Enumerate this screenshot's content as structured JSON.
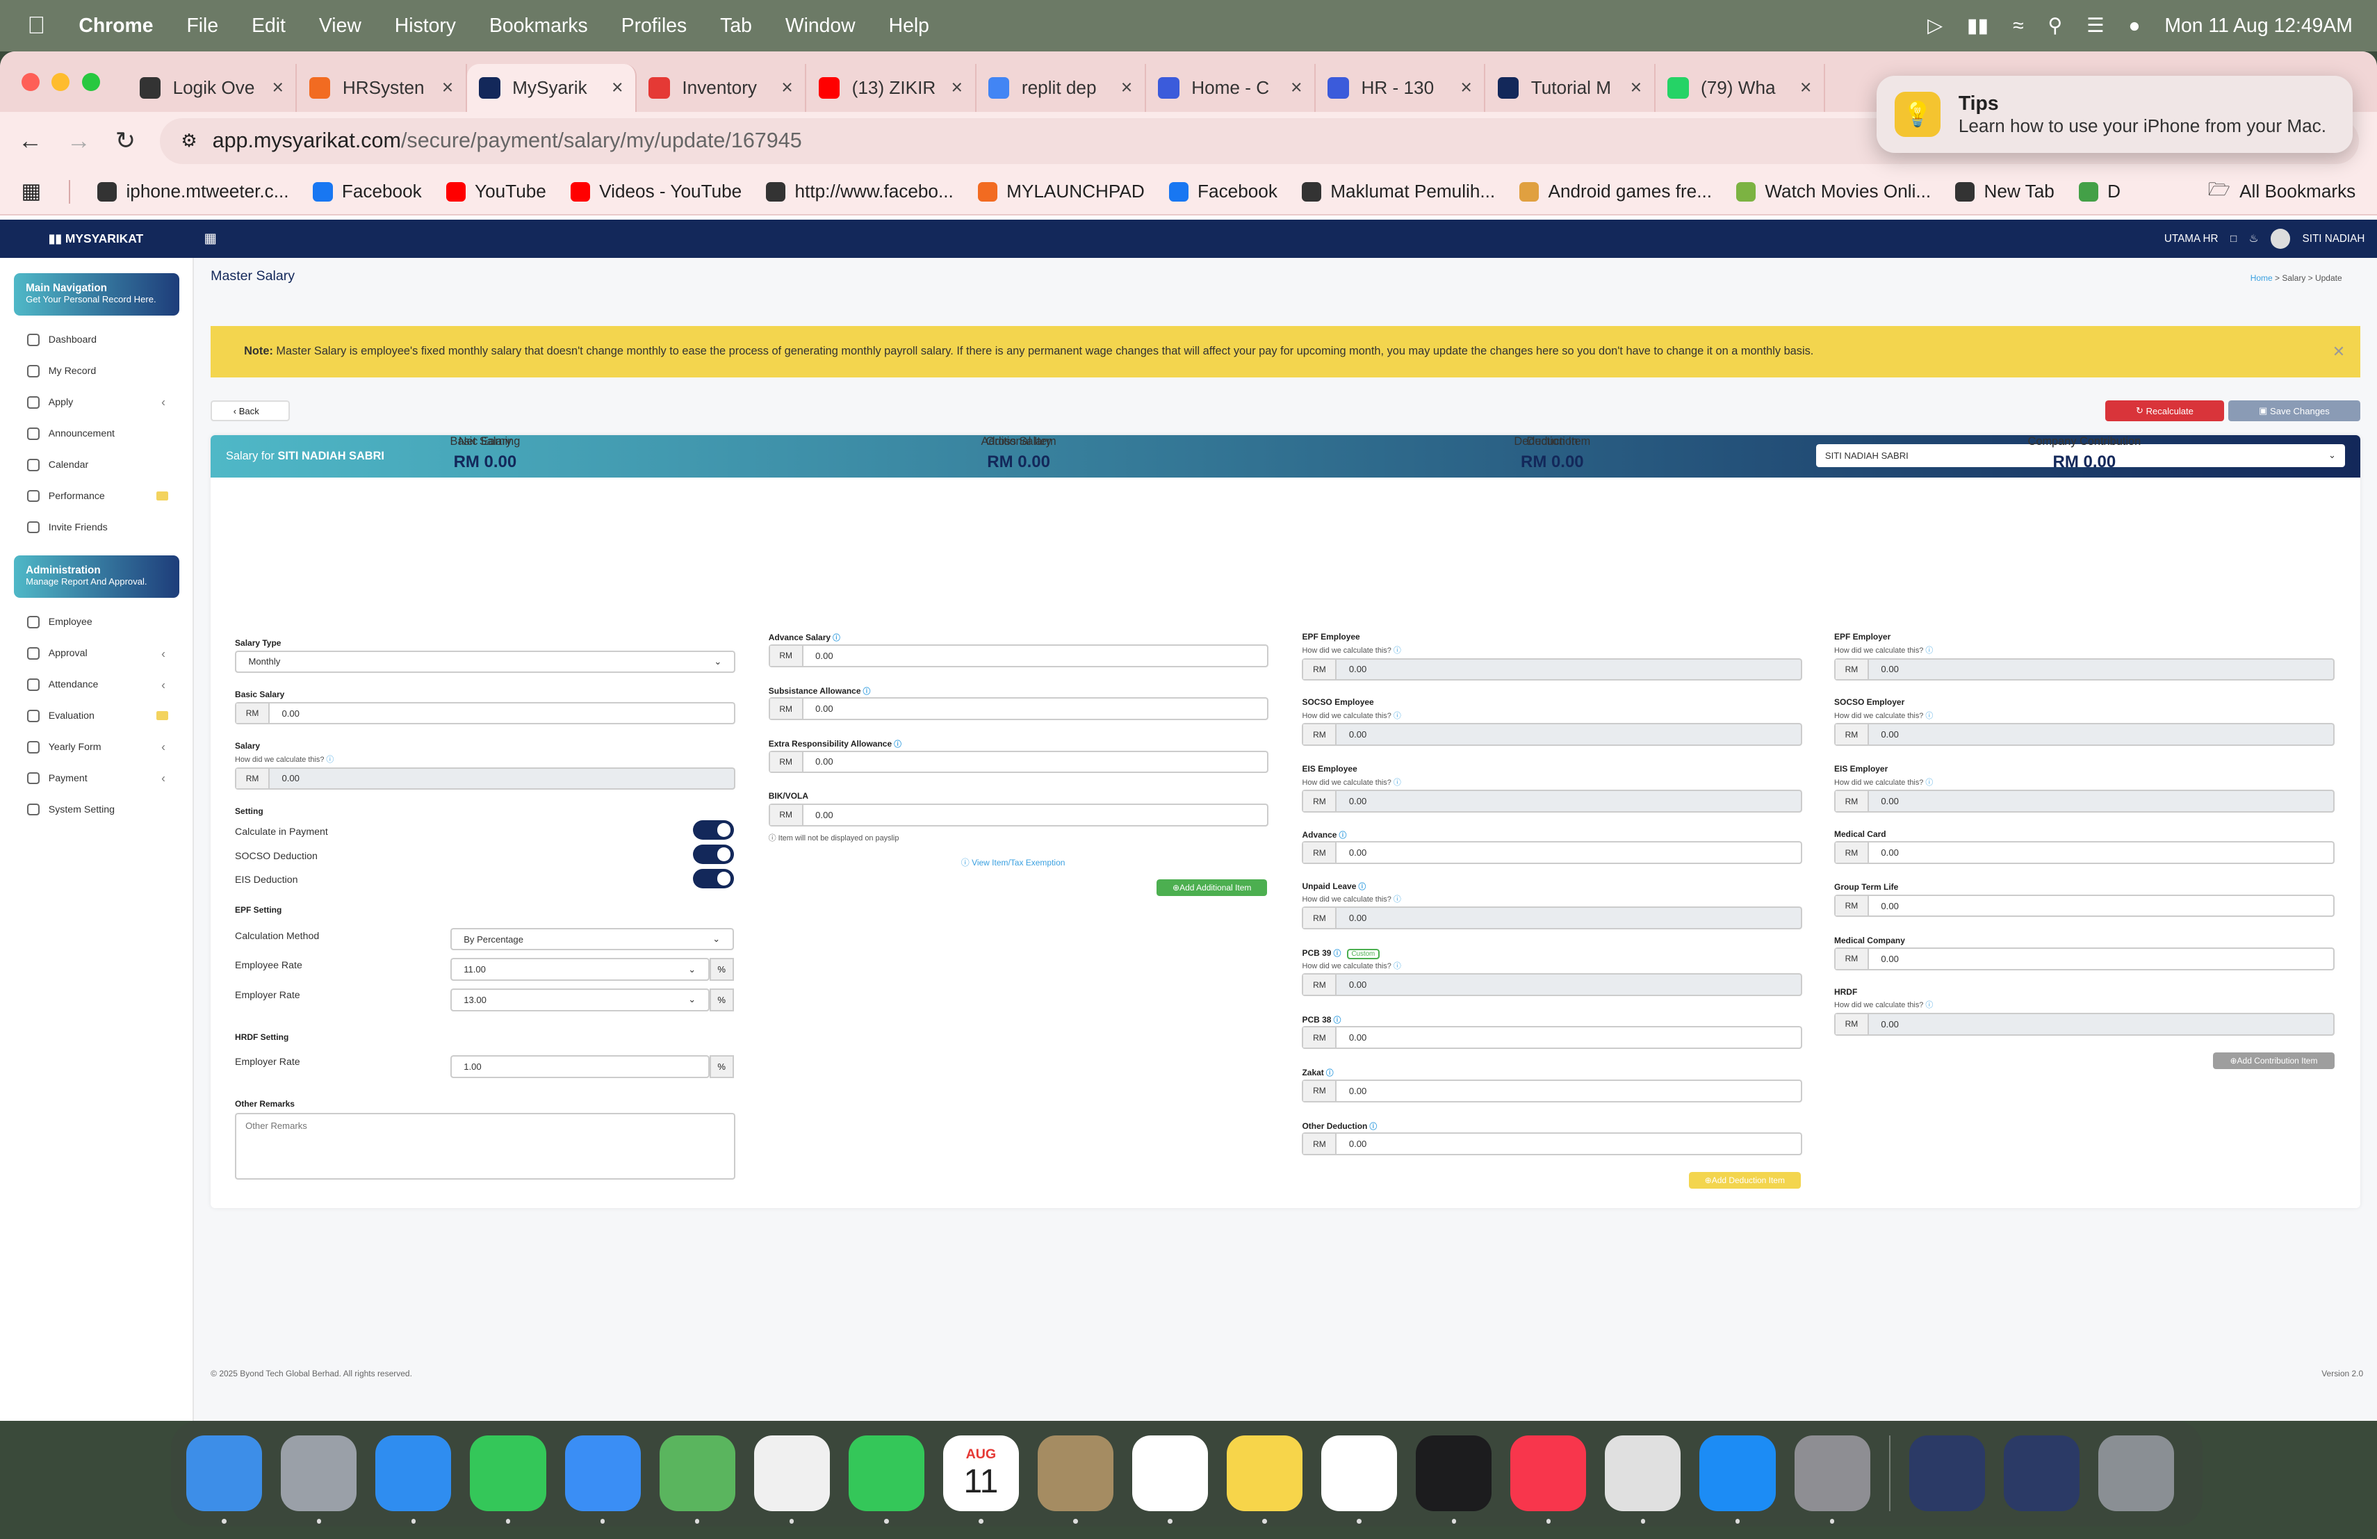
{
  "menubar": {
    "app": "Chrome",
    "items": [
      "File",
      "Edit",
      "View",
      "History",
      "Bookmarks",
      "Profiles",
      "Tab",
      "Window",
      "Help"
    ],
    "clock": "Mon 11 Aug  12:49AM"
  },
  "tabs": [
    {
      "label": "Logik Ove",
      "color": "#333333"
    },
    {
      "label": "HRSysten",
      "color": "#f26b21"
    },
    {
      "label": "MySyarik",
      "color": "#13285a",
      "active": true
    },
    {
      "label": "Inventory",
      "color": "#e53935"
    },
    {
      "label": "(13) ZIKIR",
      "color": "#ff0000"
    },
    {
      "label": "replit dep",
      "color": "#4285f4"
    },
    {
      "label": "Home - C",
      "color": "#3b5bdb"
    },
    {
      "label": "HR - 130",
      "color": "#3b5bdb"
    },
    {
      "label": "Tutorial M",
      "color": "#13285a"
    },
    {
      "label": "(79) Wha",
      "color": "#25d366"
    }
  ],
  "address": {
    "host": "app.mysyarikat.com",
    "path": "/secure/payment/salary/my/update/167945"
  },
  "bookmarks": [
    {
      "label": "iphone.mtweeter.c...",
      "color": "#333333"
    },
    {
      "label": "Facebook",
      "color": "#1877f2"
    },
    {
      "label": "YouTube",
      "color": "#ff0000"
    },
    {
      "label": "Videos - YouTube",
      "color": "#ff0000"
    },
    {
      "label": "http://www.facebo...",
      "color": "#333333"
    },
    {
      "label": "MYLAUNCHPAD",
      "color": "#f26b21"
    },
    {
      "label": "Facebook",
      "color": "#1877f2"
    },
    {
      "label": "Maklumat Pemulih...",
      "color": "#333333"
    },
    {
      "label": "Android games fre...",
      "color": "#e0a040"
    },
    {
      "label": "Watch Movies Onli...",
      "color": "#7cb342"
    },
    {
      "label": "New Tab",
      "color": "#333333"
    },
    {
      "label": "D",
      "color": "#43a047"
    }
  ],
  "all_bookmarks": "All Bookmarks",
  "tips": {
    "title": "Tips",
    "text": "Learn how to use your iPhone from your Mac."
  },
  "app": {
    "brand": "MYSYARIKAT",
    "topnav_company": "UTAMA HR",
    "topnav_user": "SITI NADIAH",
    "sidebar": {
      "main_title": "Main Navigation",
      "main_sub": "Get Your Personal Record Here.",
      "main_items": [
        "Dashboard",
        "My Record",
        "Apply",
        "Announcement",
        "Calendar",
        "Performance",
        "Invite Friends"
      ],
      "admin_title": "Administration",
      "admin_sub": "Manage Report And Approval.",
      "admin_items": [
        "Employee",
        "Approval",
        "Attendance",
        "Evaluation",
        "Yearly Form",
        "Payment",
        "System Setting"
      ]
    },
    "page_title": "Master Salary",
    "breadcrumb": {
      "home": "Home",
      "rest": " > Salary > Update"
    },
    "note_label": "Note:",
    "note_text": " Master Salary is employee's fixed monthly salary that doesn't change monthly to ease the process of generating monthly payroll salary. If there is any permanent wage changes that will affect your pay for upcoming month, you may update the changes here so you don't have to change it on a monthly basis.",
    "back": "Back",
    "recalculate": "Recalculate",
    "save": "Save Changes",
    "salary_for": "Salary for ",
    "employee_name": "SITI NADIAH SABRI",
    "summary": [
      {
        "label": "Net Salary",
        "value": "RM 0.00"
      },
      {
        "label": "Gross Salary",
        "value": "RM 0.00"
      },
      {
        "label": "Deduction",
        "value": "RM 0.00"
      },
      {
        "label": "Company Contribution",
        "value": "RM 0.00"
      }
    ],
    "columns": [
      "Basic Earning",
      "Additional Item",
      "Deduction Item",
      "Company Contribution"
    ],
    "rm": "RM",
    "calc_hint": "How did we calculate this?",
    "basic": {
      "salary_type_label": "Salary Type",
      "salary_type": "Monthly",
      "basic_salary_label": "Basic Salary",
      "basic_salary": "0.00",
      "salary_label": "Salary",
      "salary": "0.00",
      "setting_label": "Setting",
      "toggles": [
        "Calculate in Payment",
        "SOCSO Deduction",
        "EIS Deduction"
      ],
      "epf_setting": "EPF Setting",
      "calc_method_label": "Calculation Method",
      "calc_method": "By Percentage",
      "employee_rate_label": "Employee Rate",
      "employee_rate": "11.00",
      "employer_rate_label": "Employer Rate",
      "employer_rate": "13.00",
      "hrdf_setting": "HRDF Setting",
      "hrdf_rate_label": "Employer Rate",
      "hrdf_rate": "1.00",
      "percent": "%",
      "remarks_label": "Other Remarks",
      "remarks_placeholder": "Other Remarks"
    },
    "additional": {
      "items": [
        {
          "label": "Advance Salary",
          "value": "0.00"
        },
        {
          "label": "Subsistance Allowance",
          "value": "0.00"
        },
        {
          "label": "Extra Responsibility Allowance",
          "value": "0.00"
        },
        {
          "label": "BIK/VOLA",
          "value": "0.00"
        }
      ],
      "payslip_note": "Item will not be displayed on payslip",
      "view_link": "View Item/Tax Exemption",
      "add_button": "Add Additional Item"
    },
    "deduction": {
      "items": [
        {
          "label": "EPF Employee",
          "value": "0.00"
        },
        {
          "label": "SOCSO Employee",
          "value": "0.00"
        },
        {
          "label": "EIS Employee",
          "value": "0.00"
        },
        {
          "label": "Advance",
          "value": "0.00"
        },
        {
          "label": "Unpaid Leave",
          "value": "0.00"
        },
        {
          "label": "PCB 39",
          "value": "0.00"
        },
        {
          "label": "PCB 38",
          "value": "0.00"
        },
        {
          "label": "Zakat",
          "value": "0.00"
        },
        {
          "label": "Other Deduction",
          "value": "0.00"
        }
      ],
      "custom_badge": "Custom",
      "add_button": "Add Deduction Item"
    },
    "contribution": {
      "items": [
        {
          "label": "EPF Employer",
          "value": "0.00"
        },
        {
          "label": "SOCSO Employer",
          "value": "0.00"
        },
        {
          "label": "EIS Employer",
          "value": "0.00"
        },
        {
          "label": "Medical Card",
          "value": "0.00"
        },
        {
          "label": "Group Term Life",
          "value": "0.00"
        },
        {
          "label": "Medical Company",
          "value": "0.00"
        },
        {
          "label": "HRDF",
          "value": "0.00"
        }
      ],
      "add_button": "Add Contribution Item"
    },
    "footer": "© 2025 Byond Tech Global Berhad. All rights reserved.",
    "version": "Version 2.0"
  },
  "dock": [
    {
      "name": "finder-icon",
      "color": "#3d8ee8"
    },
    {
      "name": "launchpad-icon",
      "color": "#9aa0a8"
    },
    {
      "name": "safari-icon",
      "color": "#2f8df0"
    },
    {
      "name": "messages-icon",
      "color": "#34c759"
    },
    {
      "name": "mail-icon",
      "color": "#3a8ef5"
    },
    {
      "name": "maps-icon",
      "color": "#5ab55e"
    },
    {
      "name": "photos-icon",
      "color": "#f0f0f0"
    },
    {
      "name": "facetime-icon",
      "color": "#34c759"
    },
    {
      "name": "calendar-icon",
      "color": "#ffffff"
    },
    {
      "name": "contacts-icon",
      "color": "#a58c62"
    },
    {
      "name": "reminders-icon",
      "color": "#ffffff"
    },
    {
      "name": "notes-icon",
      "color": "#f7d54a"
    },
    {
      "name": "freeform-icon",
      "color": "#ffffff"
    },
    {
      "name": "tv-icon",
      "color": "#1c1c1e"
    },
    {
      "name": "music-icon",
      "color": "#f8364c"
    },
    {
      "name": "chrome-icon",
      "color": "#e0e0e0"
    },
    {
      "name": "app-store-icon",
      "color": "#1c8cf5"
    },
    {
      "name": "system-settings-icon",
      "color": "#8e8e93"
    }
  ],
  "dock_calendar": {
    "month": "AUG",
    "day": "11"
  }
}
